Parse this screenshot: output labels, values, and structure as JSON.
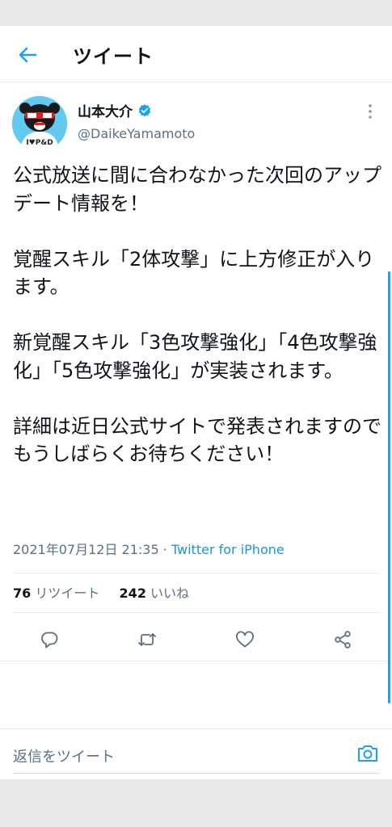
{
  "header": {
    "title": "ツイート"
  },
  "author": {
    "name": "山本大介",
    "handle": "@DaikeYamamoto",
    "avatar_text": "I♥P&D"
  },
  "tweet": {
    "text": "公式放送に間に合わなかった次回のアップデート情報を！\n\n覚醒スキル「2体攻撃」に上方修正が入ります。\n\n新覚醒スキル「3色攻撃強化」「4色攻撃強化」「5色攻撃強化」が実装されます。\n\n詳細は近日公式サイトで発表されますのでもうしばらくお待ちください！",
    "timestamp": "2021年07月12日 21:35",
    "separator": " · ",
    "source": "Twitter for iPhone"
  },
  "stats": {
    "retweets": "76",
    "retweets_label": " リツイート",
    "likes": "242",
    "likes_label": " いいね"
  },
  "reply": {
    "placeholder": "返信をツイート"
  },
  "colors": {
    "accent": "#1da1f2",
    "secondary_text": "#5b7083",
    "source_link": "#1b95e0"
  },
  "icons": [
    "back-arrow-icon",
    "verified-badge-icon",
    "more-vertical-icon",
    "reply-icon",
    "retweet-icon",
    "like-icon",
    "share-icon",
    "camera-icon"
  ]
}
